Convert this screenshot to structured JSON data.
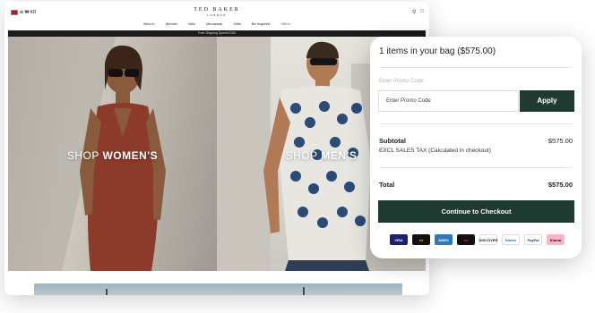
{
  "store": {
    "region": "⊕ ₩ KR",
    "logo_main": "TED BAKER",
    "logo_sub": "LONDON",
    "nav": [
      "New In",
      "Women",
      "Men",
      "Menswear",
      "Gifts",
      "Be Inspired",
      "Offers"
    ],
    "strip_text": "Free Shipping Spend £150",
    "women_prefix": "SHOP ",
    "women_bold": "WOMEN'S",
    "men_prefix": "SHOP ",
    "men_bold": "MEN'S"
  },
  "cart": {
    "title": "1 items in your bag ($575.00)",
    "promo_label": "Enter Promo Code",
    "promo_placeholder": "Enter Promo Code",
    "apply_label": "Apply",
    "subtotal_label": "Subtotal",
    "subtotal_value": "$575.00",
    "tax_note": "EXCL SALES TAX (Calculated in checkout)",
    "total_label": "Total",
    "total_value": "$575.00",
    "checkout_label": "Continue to Checkout",
    "accent_color": "#1e3a31",
    "payment_methods": [
      {
        "name": "visa-icon",
        "label": "VISA",
        "bg": "#1a1f71",
        "fg": "#ffffff"
      },
      {
        "name": "mastercard-icon",
        "label": "●●",
        "bg": "#111111",
        "fg": "#f79e1b"
      },
      {
        "name": "amex-icon",
        "label": "AMEX",
        "bg": "#2e77bc",
        "fg": "#ffffff"
      },
      {
        "name": "maestro-icon",
        "label": "●●",
        "bg": "#111111",
        "fg": "#e11b22"
      },
      {
        "name": "discover-icon",
        "label": "DISCOVER",
        "bg": "#ffffff",
        "fg": "#222222"
      },
      {
        "name": "diners-icon",
        "label": "Diners",
        "bg": "#ffffff",
        "fg": "#0a6bb3"
      },
      {
        "name": "paypal-icon",
        "label": "PayPal",
        "bg": "#ffffff",
        "fg": "#1f3a8a"
      },
      {
        "name": "klarna-icon",
        "label": "Klarna",
        "bg": "#ffb3c7",
        "fg": "#111111"
      }
    ]
  }
}
